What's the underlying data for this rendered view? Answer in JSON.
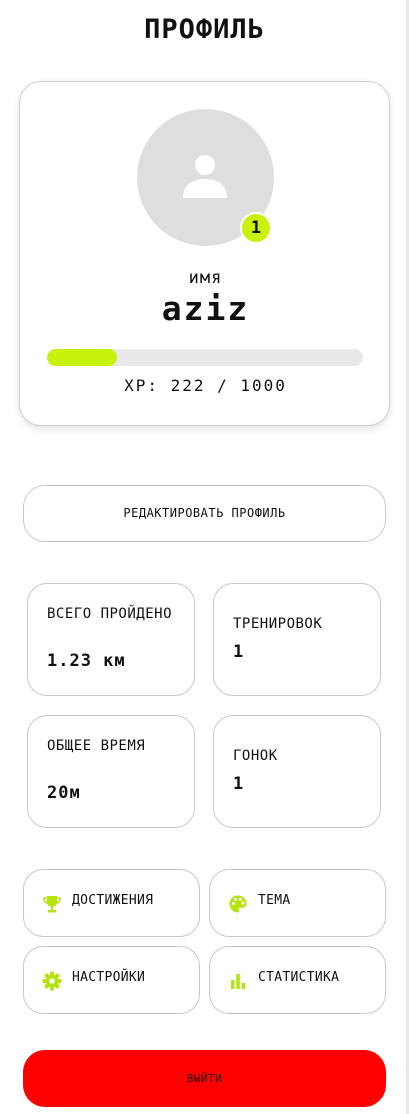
{
  "header": {
    "title": "Профиль"
  },
  "profile": {
    "level": "1",
    "name_label": "имя",
    "username": "aziz",
    "xp_current": 222,
    "xp_max": 1000,
    "xp_fraction": 0.222,
    "xp_text": "XP: 222 / 1000"
  },
  "edit_button": {
    "label": "Редактировать профиль"
  },
  "stats": {
    "distance": {
      "label": "всего пройдено",
      "value": "1.23 км"
    },
    "workouts": {
      "label": "тренировок",
      "value": "1"
    },
    "time": {
      "label": "общее время",
      "value": "20м"
    },
    "races": {
      "label": "гонок",
      "value": "1"
    }
  },
  "menu": {
    "achievements": {
      "label": "достижения",
      "icon": "trophy-icon"
    },
    "theme": {
      "label": "тема",
      "icon": "palette-icon"
    },
    "settings": {
      "label": "настройки",
      "icon": "gear-icon"
    },
    "statistics": {
      "label": "статистика",
      "icon": "bar-chart-icon"
    }
  },
  "logout_button": {
    "label": "выйти"
  },
  "colors": {
    "accent": "#c8f20c",
    "danger": "#ff0000",
    "avatar_bg": "#dedede",
    "border": "#c8c8c8"
  }
}
